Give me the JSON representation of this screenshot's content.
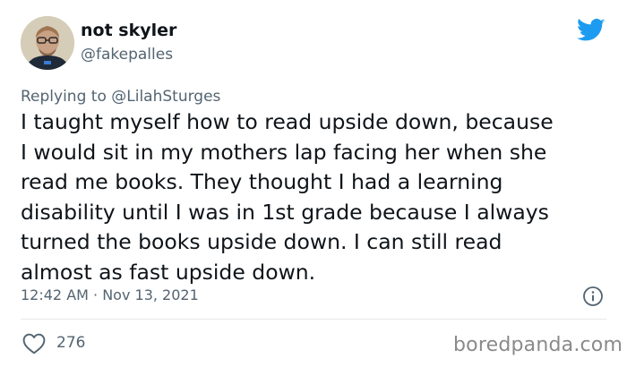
{
  "author": {
    "display_name": "not skyler",
    "handle": "@fakepalles"
  },
  "reply": {
    "prefix": "Replying to ",
    "mention": "@LilahSturges"
  },
  "body_lines": [
    "I taught myself how to read upside down, because",
    "I would sit in my mothers lap facing her when she",
    "read me books. They thought I had a learning",
    "disability until I was in 1st grade because I always",
    "turned the books upside down. I can still read",
    "almost as fast upside down."
  ],
  "meta": {
    "timestamp": "12:42 AM · Nov 13, 2021"
  },
  "engagement": {
    "likes": "276"
  },
  "watermark": "boredpanda.com",
  "icons": {
    "brand": "twitter-bird-icon",
    "info": "info-icon",
    "like": "heart-icon"
  },
  "colors": {
    "twitter_blue": "#1d9bf0",
    "text_primary": "#0f1419",
    "text_secondary": "#536471"
  }
}
